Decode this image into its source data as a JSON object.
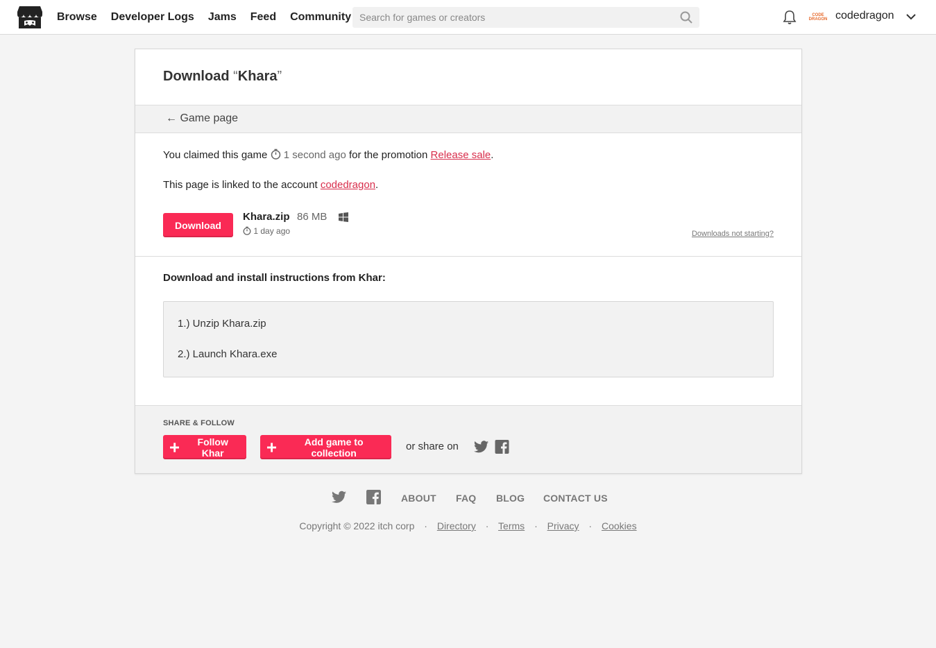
{
  "header": {
    "nav": [
      "Browse",
      "Developer Logs",
      "Jams",
      "Feed",
      "Community"
    ],
    "search_placeholder": "Search for games or creators",
    "avatar_text": "CODE DRAGON",
    "username": "codedragon"
  },
  "page": {
    "title_prefix": "Download ",
    "title_open_quote": "“",
    "title_game": "Khara",
    "title_close_quote": "”",
    "back_label": "← Game page",
    "claim_prefix": "You claimed this game",
    "claim_time": "1 second ago",
    "claim_middle": "for the promotion",
    "promotion_link": "Release sale",
    "linked_prefix": "This page is linked to the account",
    "account_link": "codedragon",
    "download_button": "Download",
    "file": {
      "name": "Khara.zip",
      "size": "86 MB",
      "date": "1 day ago",
      "platform_icon": "windows-icon"
    },
    "not_starting": "Downloads not starting?",
    "instructions_heading": "Download and install instructions from Khar:",
    "instructions": [
      "1.) Unzip Khara.zip",
      "2.) Launch Khara.exe"
    ],
    "share_label": "SHARE & FOLLOW",
    "follow_button": "Follow Khar",
    "collection_button": "Add game to collection",
    "or_share": "or share on"
  },
  "footer": {
    "links": [
      "ABOUT",
      "FAQ",
      "BLOG",
      "CONTACT US"
    ],
    "copyright": "Copyright © 2022 itch corp",
    "legal": [
      "Directory",
      "Terms",
      "Privacy",
      "Cookies"
    ],
    "separator": "·"
  },
  "colors": {
    "accent": "#fa2a55",
    "link": "#d82d4b"
  }
}
